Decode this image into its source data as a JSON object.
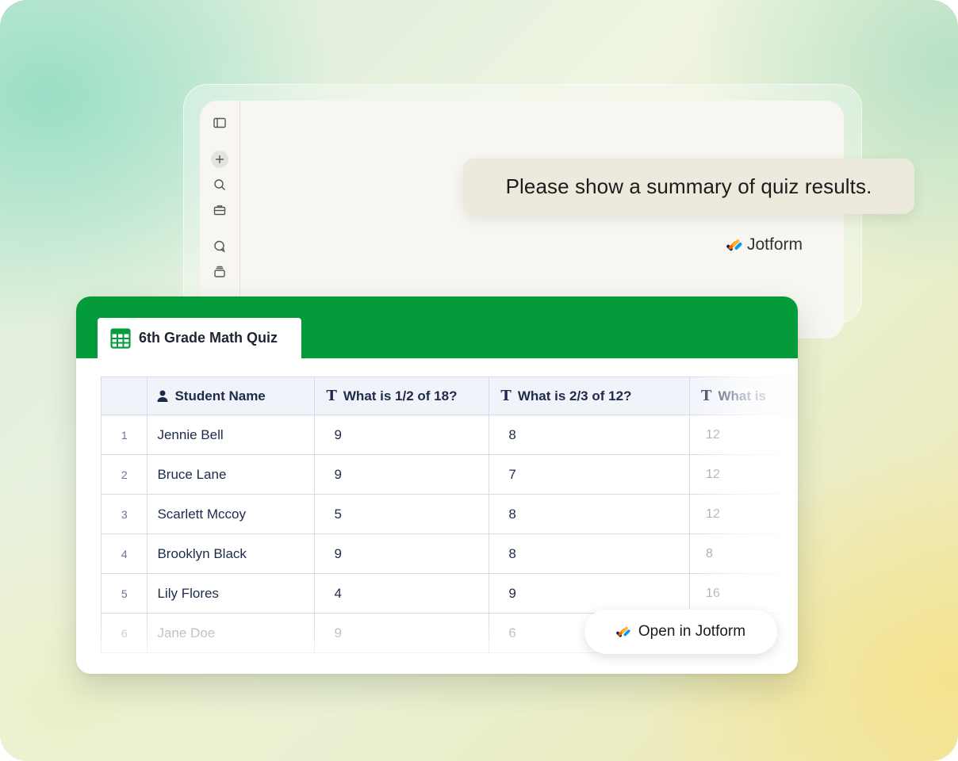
{
  "chat": {
    "user_message": "Please show a summary of quiz results."
  },
  "brand": {
    "name": "Jotform"
  },
  "sidebar": {
    "icons": [
      "sidebar-toggle-icon",
      "plus-icon",
      "search-icon",
      "briefcase-icon",
      "chat-icon",
      "stack-icon"
    ]
  },
  "sheet": {
    "tab_label": "6th Grade Math Quiz",
    "header_color": "#049c3a",
    "columns": [
      {
        "label": "",
        "icon": ""
      },
      {
        "label": "Student Name",
        "icon": "person-icon"
      },
      {
        "label": "What is 1/2 of 18?",
        "icon": "text-icon"
      },
      {
        "label": "What is 2/3 of 12?",
        "icon": "text-icon"
      },
      {
        "label": "What is",
        "icon": "text-icon"
      }
    ],
    "rows": [
      {
        "num": "1",
        "name": "Jennie Bell",
        "q1": "9",
        "q2": "8",
        "q3": "12"
      },
      {
        "num": "2",
        "name": "Bruce Lane",
        "q1": "9",
        "q2": "7",
        "q3": "12"
      },
      {
        "num": "3",
        "name": "Scarlett Mccoy",
        "q1": "5",
        "q2": "8",
        "q3": "12"
      },
      {
        "num": "4",
        "name": "Brooklyn Black",
        "q1": "9",
        "q2": "8",
        "q3": "8"
      },
      {
        "num": "5",
        "name": "Lily Flores",
        "q1": "4",
        "q2": "9",
        "q3": "16"
      },
      {
        "num": "6",
        "name": "Jane Doe",
        "q1": "9",
        "q2": "6",
        "q3": ""
      }
    ]
  },
  "actions": {
    "open_label": "Open in Jotform"
  }
}
